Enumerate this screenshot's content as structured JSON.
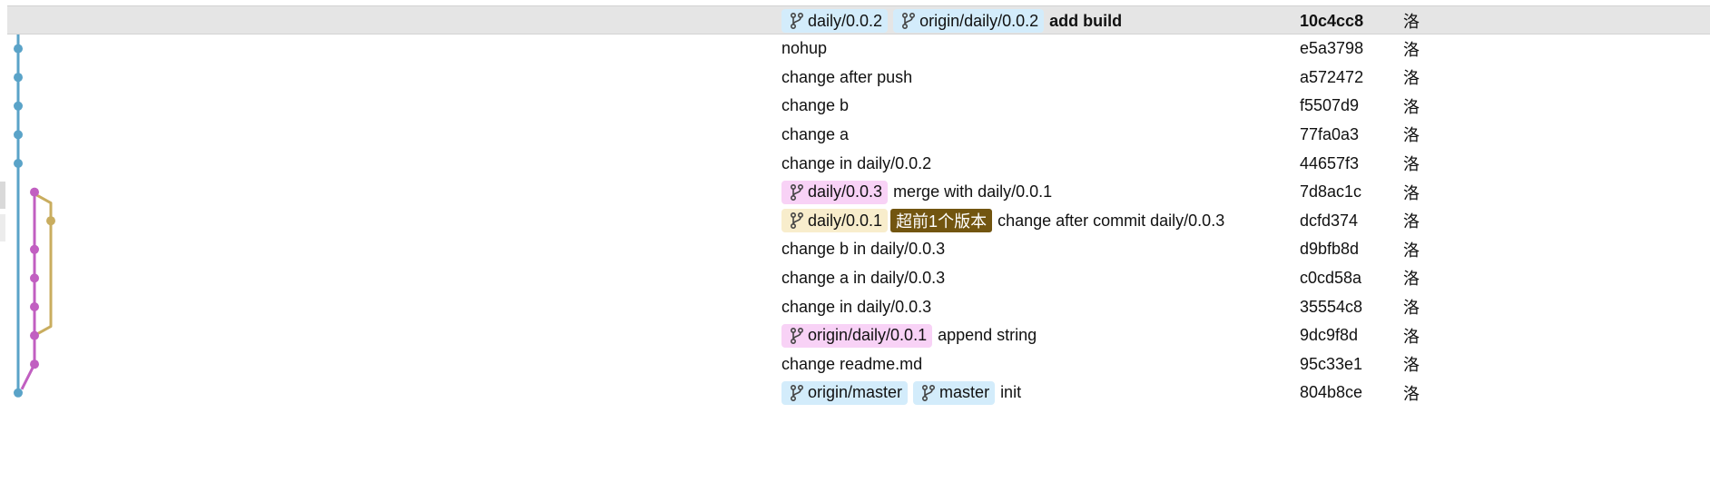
{
  "colors": {
    "lane_blue": "#5aa3c8",
    "lane_pink": "#c15fc1",
    "lane_gold": "#c9ad5f",
    "tag_blue": "#d3ecfb",
    "tag_pink": "#f8d2f6",
    "tag_yellow": "#f8edcc",
    "ahead_badge": "#725510",
    "selected_row": "#e5e5e5"
  },
  "commits": [
    {
      "tags": [
        {
          "label": "daily/0.0.2",
          "color": "blue"
        },
        {
          "label": "origin/daily/0.0.2",
          "color": "blue"
        }
      ],
      "message": "add build",
      "hash": "10c4cc8",
      "author": "洛",
      "bold": true,
      "selected": true,
      "lane": "blue"
    },
    {
      "tags": [],
      "message": "nohup",
      "hash": "e5a3798",
      "author": "洛",
      "lane": "blue"
    },
    {
      "tags": [],
      "message": "change after push",
      "hash": "a572472",
      "author": "洛",
      "lane": "blue"
    },
    {
      "tags": [],
      "message": "change b",
      "hash": "f5507d9",
      "author": "洛",
      "lane": "blue"
    },
    {
      "tags": [],
      "message": "change a",
      "hash": "77fa0a3",
      "author": "洛",
      "lane": "blue"
    },
    {
      "tags": [],
      "message": "change in daily/0.0.2",
      "hash": "44657f3",
      "author": "洛",
      "lane": "blue"
    },
    {
      "tags": [
        {
          "label": "daily/0.0.3",
          "color": "pink"
        }
      ],
      "message": "merge with daily/0.0.1",
      "hash": "7d8ac1c",
      "author": "洛",
      "lane": "pink"
    },
    {
      "tags": [
        {
          "label": "daily/0.0.1",
          "color": "yellow"
        }
      ],
      "ahead": "超前1个版本",
      "message": "change after commit daily/0.0.3",
      "hash": "dcfd374",
      "author": "洛",
      "lane": "gold"
    },
    {
      "tags": [],
      "message": "change b in daily/0.0.3",
      "hash": "d9bfb8d",
      "author": "洛",
      "lane": "pink"
    },
    {
      "tags": [],
      "message": "change a in daily/0.0.3",
      "hash": "c0cd58a",
      "author": "洛",
      "lane": "pink"
    },
    {
      "tags": [],
      "message": "change in daily/0.0.3",
      "hash": "35554c8",
      "author": "洛",
      "lane": "pink"
    },
    {
      "tags": [
        {
          "label": "origin/daily/0.0.1",
          "color": "pink"
        }
      ],
      "message": "append string",
      "hash": "9dc9f8d",
      "author": "洛",
      "lane": "pink"
    },
    {
      "tags": [],
      "message": "change readme.md",
      "hash": "95c33e1",
      "author": "洛",
      "lane": "pink"
    },
    {
      "tags": [
        {
          "label": "origin/master",
          "color": "blue"
        },
        {
          "label": "master",
          "color": "blue"
        }
      ],
      "message": "init",
      "hash": "804b8ce",
      "author": "洛",
      "lane": "blue"
    }
  ]
}
